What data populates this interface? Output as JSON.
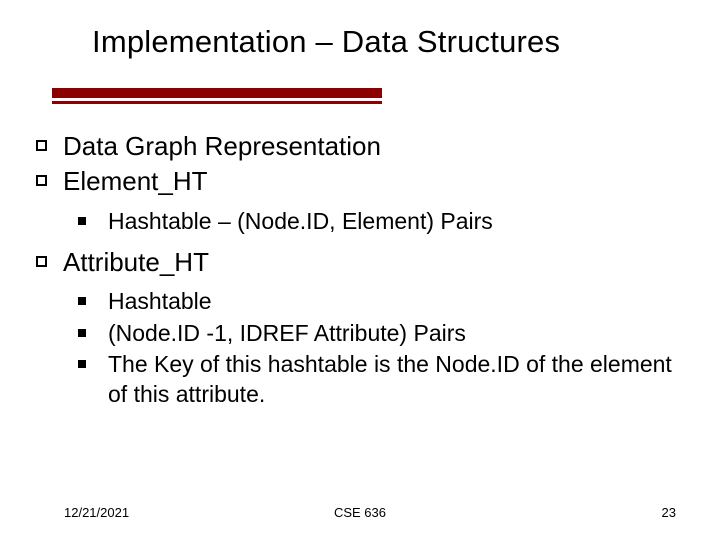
{
  "title": "Implementation – Data Structures",
  "bullets": {
    "l1_0": "Data Graph Representation",
    "l1_1": "Element_HT",
    "l1_1_sub": {
      "s0": "Hashtable – (Node.ID, Element) Pairs"
    },
    "l1_2": "Attribute_HT",
    "l1_2_sub": {
      "s0": "Hashtable",
      "s1": "(Node.ID -1, IDREF Attribute) Pairs",
      "s2": "The Key of this hashtable is the Node.ID of the element of this attribute."
    }
  },
  "footer": {
    "date": "12/21/2021",
    "course": "CSE 636",
    "page": "23"
  }
}
